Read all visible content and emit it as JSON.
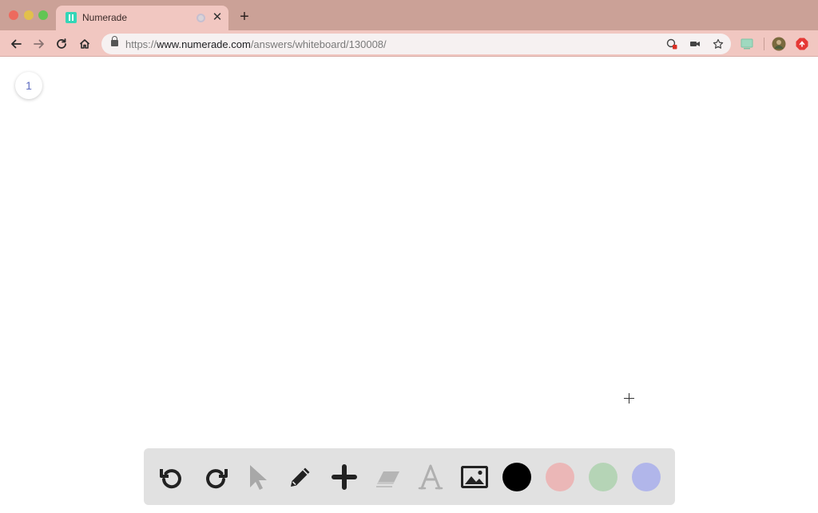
{
  "browser": {
    "tab": {
      "title": "Numerade"
    },
    "address": {
      "scheme": "https://",
      "host": "www.numerade.com",
      "path": "/answers/whiteboard/130008/"
    }
  },
  "page": {
    "page_number": "1"
  },
  "icons": {
    "back": "arrow-left-icon",
    "forward": "arrow-right-icon",
    "reload": "reload-icon",
    "home": "home-icon",
    "undo": "undo-icon",
    "redo": "redo-icon",
    "select": "cursor-arrow-icon",
    "pen": "pencil-icon",
    "add": "plus-icon",
    "eraser": "eraser-icon",
    "text": "text-icon",
    "image": "image-icon"
  },
  "colors": {
    "tabstrip_bg": "#cba197",
    "toolbar_bg": "#f1c7c1",
    "page_number": "#5c6bc0",
    "swatches": [
      "#000000",
      "#ebb7b7",
      "#b5d4b6",
      "#b1b6ea"
    ]
  }
}
